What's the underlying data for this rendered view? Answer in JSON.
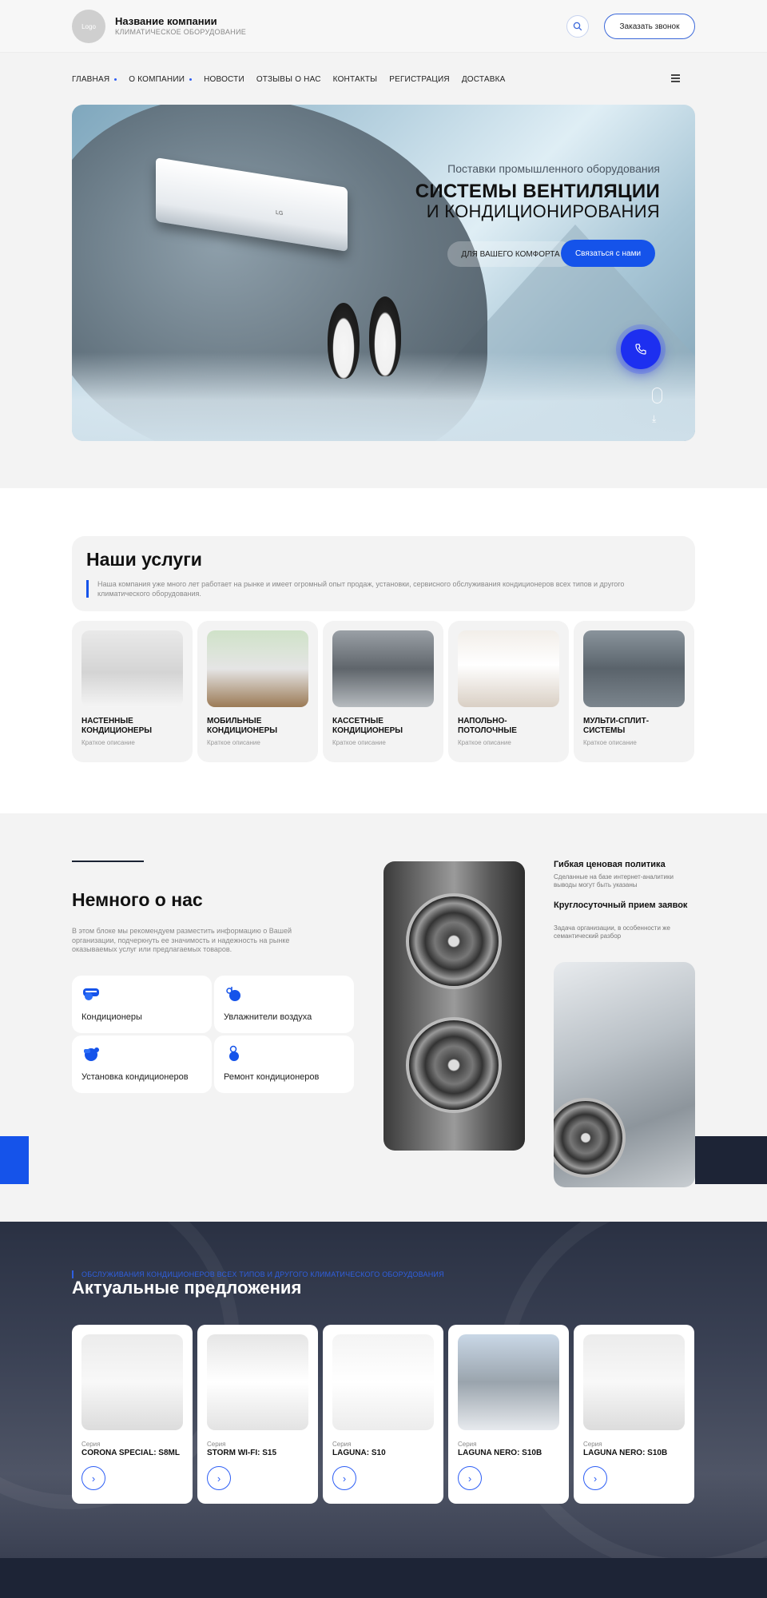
{
  "header": {
    "logo_text": "Logo",
    "company_name": "Название компании",
    "company_sub": "КЛИМАТИЧЕСКОЕ ОБОРУДОВАНИЕ",
    "call_button": "Заказать звонок",
    "search_icon": "search-icon"
  },
  "nav": {
    "items": [
      {
        "label": "ГЛАВНАЯ",
        "has_dropdown": true
      },
      {
        "label": "О КОМПАНИИ",
        "has_dropdown": true
      },
      {
        "label": "НОВОСТИ",
        "has_dropdown": false
      },
      {
        "label": "ОТЗЫВЫ О НАС",
        "has_dropdown": false
      },
      {
        "label": "КОНТАКТЫ",
        "has_dropdown": false
      },
      {
        "label": "РЕГИСТРАЦИЯ",
        "has_dropdown": false
      },
      {
        "label": "ДОСТАВКА",
        "has_dropdown": false
      }
    ],
    "menu_icon": "hamburger-icon"
  },
  "hero": {
    "subtitle": "Поставки промышленного оборудования",
    "title_line1": "СИСТЕМЫ ВЕНТИЛЯЦИИ",
    "title_line2": "И КОНДИЦИОНИРОВАНИЯ",
    "comfort_label": "ДЛЯ ВАШЕГО КОМФОРТА",
    "contact_button": "Связаться с нами",
    "ac_brand": "LG"
  },
  "services": {
    "title": "Наши услуги",
    "description": "Наша компания уже много лет работает на рынке и имеет огромный опыт продаж, установки, сервисного обслуживания кондиционеров всех типов и другого климатического оборудования.",
    "items": [
      {
        "title": "НАСТЕННЫЕ КОНДИЦИОНЕРЫ",
        "desc": "Краткое описание"
      },
      {
        "title": "МОБИЛЬНЫЕ КОНДИЦИОНЕРЫ",
        "desc": "Краткое описание"
      },
      {
        "title": "КАССЕТНЫЕ КОНДИЦИОНЕРЫ",
        "desc": "Краткое описание"
      },
      {
        "title": "НАПОЛЬНО-ПОТОЛОЧНЫЕ",
        "desc": "Краткое описание"
      },
      {
        "title": "МУЛЬТИ-СПЛИТ-СИСТЕМЫ",
        "desc": "Краткое описание"
      }
    ]
  },
  "about": {
    "title": "Немного о нас",
    "description": "В этом блоке мы рекомендуем разместить информацию о Вашей организации, подчеркнуть ее значимость и надежность на рынке оказываемых услуг или предлагаемых товаров.",
    "cards": [
      {
        "label": "Кондиционеры",
        "icon": "ac-icon"
      },
      {
        "label": "Увлажнители воздуха",
        "icon": "humidifier-icon"
      },
      {
        "label": "Установка кондиционеров",
        "icon": "installation-icon"
      },
      {
        "label": "Ремонт кондиционеров",
        "icon": "repair-icon"
      }
    ],
    "features": [
      {
        "title": "Гибкая ценовая политика",
        "desc": "Сделанные на базе интернет-аналитики выводы могут быть указаны"
      },
      {
        "title": "Круглосуточный прием заявок",
        "desc": "Задача организации, в особенности же семантический разбор"
      }
    ]
  },
  "offers": {
    "subtitle": "ОБСЛУЖИВАНИЯ КОНДИЦИОНЕРОВ ВСЕХ ТИПОВ И ДРУГОГО КЛИМАТИЧЕСКОГО ОБОРУДОВАНИЯ",
    "title": "Актуальные предложения",
    "items": [
      {
        "series_label": "Серия",
        "name": "CORONA SPECIAL: S8ML"
      },
      {
        "series_label": "Серия",
        "name": "STORM WI-FI: S15"
      },
      {
        "series_label": "Серия",
        "name": "LAGUNA: S10"
      },
      {
        "series_label": "Серия",
        "name": "LAGUNA NERO: S10B"
      },
      {
        "series_label": "Серия",
        "name": "LAGUNA NERO: S10B"
      }
    ]
  },
  "colors": {
    "accent": "#1553ea",
    "dark": "#1d2436"
  }
}
